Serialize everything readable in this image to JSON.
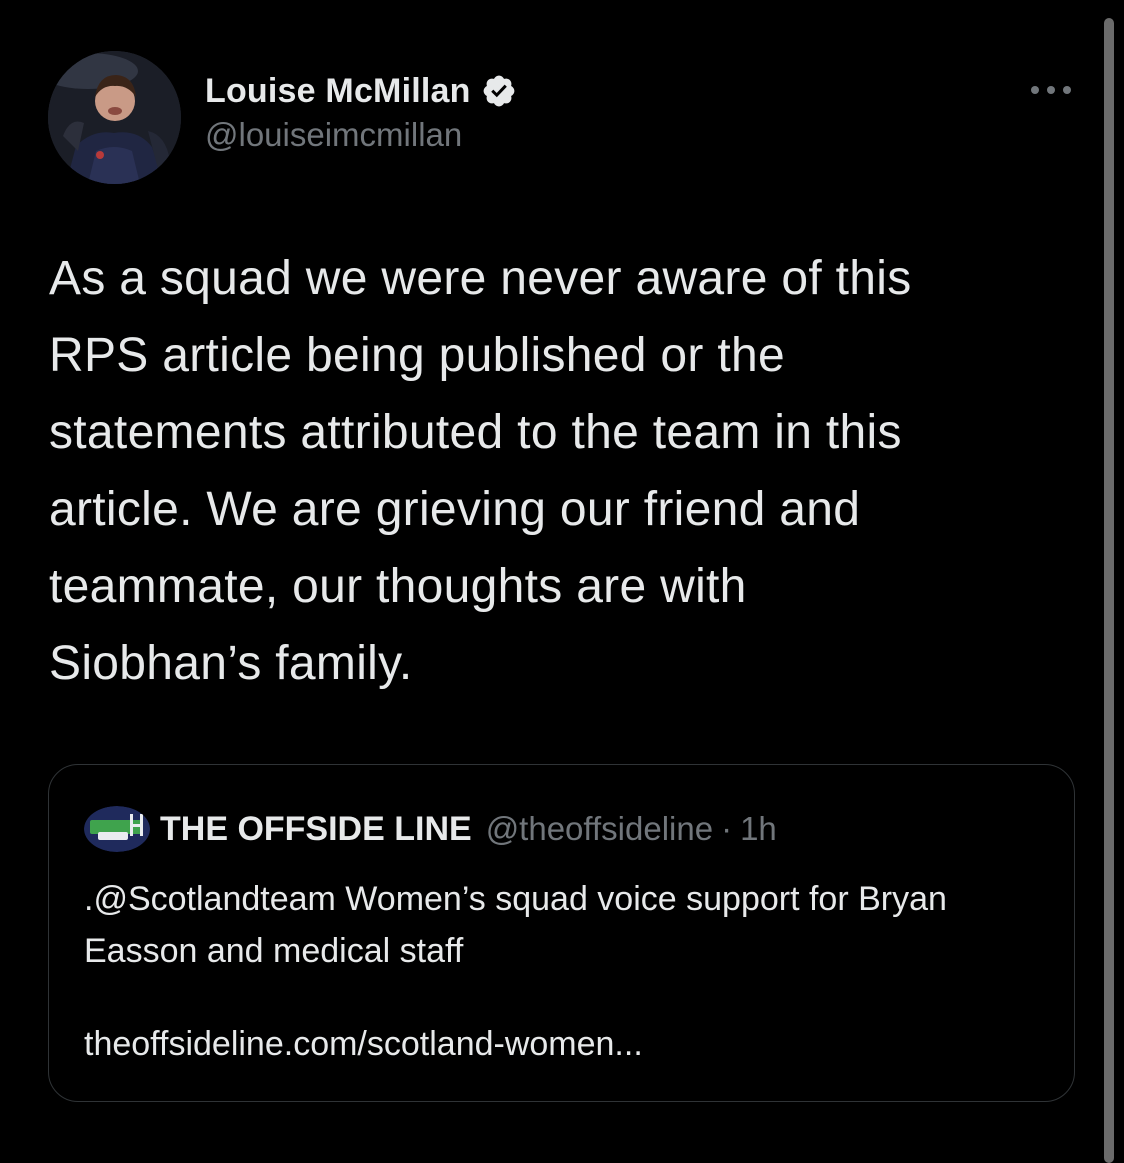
{
  "tweet": {
    "author": {
      "display_name": "Louise McMillan",
      "handle": "@louiseimcmillan",
      "verified": true,
      "avatar": "profile-photo"
    },
    "text": "As a squad we were never aware of this\nRPS article being published or the\nstatements attributed to the team in this\narticle. We are grieving our friend and\nteammate, our thoughts are with\nSiobhan’s family.",
    "more_icon": "more-horizontal-icon"
  },
  "quote": {
    "author": {
      "display_name": "THE OFFSIDE LINE",
      "handle": "@theoffsideline",
      "separator": "·",
      "time": "1h",
      "avatar": "the-offside-line-logo"
    },
    "text": ".@Scotlandteam Women’s squad voice support for Bryan Easson and medical staff",
    "link": "theoffsideline.com/scotland-women..."
  },
  "colors": {
    "background": "#000000",
    "primary_text": "#e7e9ea",
    "secondary_text": "#71767b",
    "border": "#2f3336",
    "verified_badge": "#e7e9ea"
  }
}
